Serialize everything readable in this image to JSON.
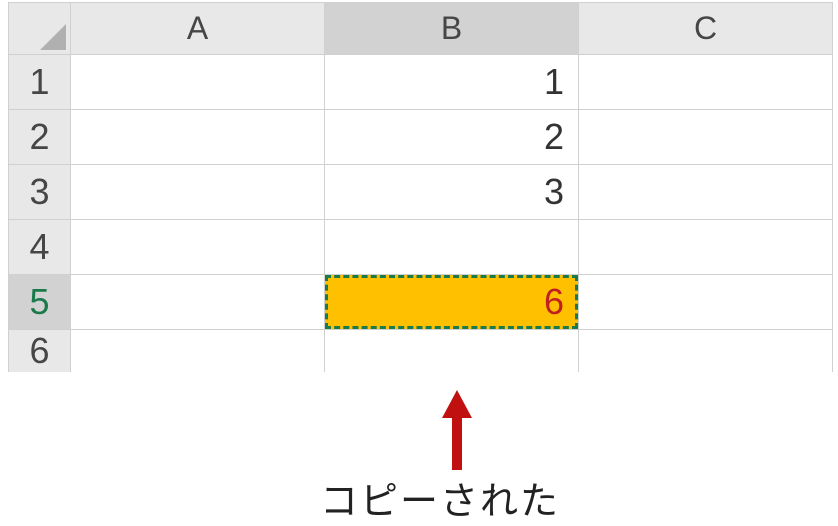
{
  "columns": [
    "A",
    "B",
    "C"
  ],
  "rows": [
    "1",
    "2",
    "3",
    "4",
    "5",
    "6"
  ],
  "selected_column_index": 1,
  "selected_row_index": 4,
  "cells": {
    "B1": "1",
    "B2": "2",
    "B3": "3",
    "B5": "6"
  },
  "highlight_cell": "B5",
  "copy_marquee_cell": "B5",
  "annotation": {
    "text": "コピーされた"
  }
}
